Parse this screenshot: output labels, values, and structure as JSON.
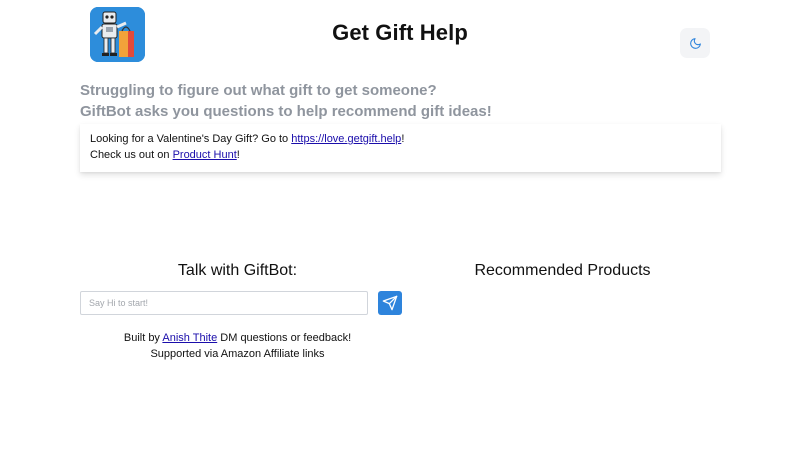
{
  "header": {
    "title": "Get Gift Help",
    "logo_icon": "robot-gift-icon",
    "theme_toggle_icon": "moon-icon"
  },
  "intro": {
    "line1": "Struggling to figure out what gift to get someone?",
    "line2": "GiftBot asks you questions to help recommend gift ideas!"
  },
  "banner": {
    "line1_prefix": "Looking for a Valentine's Day Gift? Go to ",
    "line1_link": "https://love.getgift.help",
    "line1_suffix": "!",
    "line2_prefix": "Check us out on ",
    "line2_link": "Product Hunt",
    "line2_suffix": "!"
  },
  "chat": {
    "title": "Talk with GiftBot:",
    "input_placeholder": "Say Hi to start!",
    "input_value": "",
    "send_icon": "send-icon"
  },
  "products": {
    "title": "Recommended Products"
  },
  "footer": {
    "built_by_prefix": "Built by ",
    "author_link": "Anish Thite",
    "built_by_suffix": " DM questions or feedback!",
    "affiliate_note": "Supported via Amazon Affiliate links"
  },
  "colors": {
    "accent": "#2e84dc",
    "logo_bg": "#2d8ddb",
    "intro_text": "#8f959e",
    "link": "#1a0dab"
  }
}
